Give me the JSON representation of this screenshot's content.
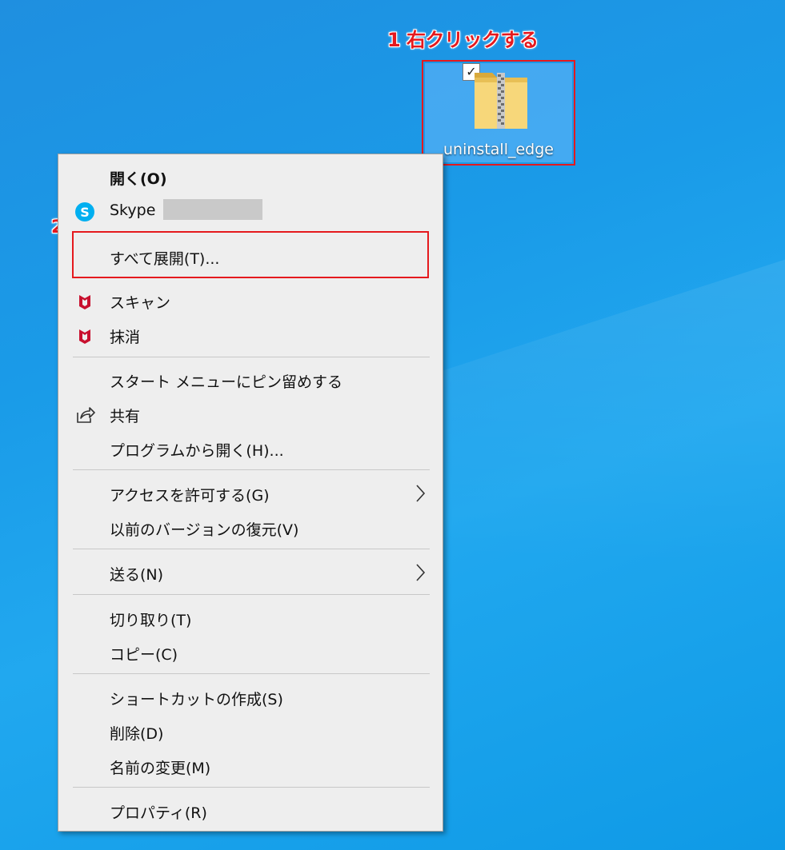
{
  "annotations": {
    "step1": "1 右クリックする",
    "step2": "2"
  },
  "desktop_icon": {
    "label": "uninstall_edge",
    "checkbox_mark": "✓",
    "icon_name": "zip-folder-icon"
  },
  "context_menu": {
    "items": [
      {
        "label": "開く(O)",
        "bold": true
      },
      {
        "label": "Skype",
        "icon": "skype-icon"
      },
      {
        "label": "すべて展開(T)..."
      },
      {
        "label": "スキャン",
        "icon": "mcafee-icon"
      },
      {
        "label": "抹消",
        "icon": "mcafee-icon"
      },
      {
        "label": "スタート メニューにピン留めする"
      },
      {
        "label": "共有",
        "icon": "share-icon"
      },
      {
        "label": "プログラムから開く(H)..."
      },
      {
        "label": "アクセスを許可する(G)",
        "submenu": true
      },
      {
        "label": "以前のバージョンの復元(V)"
      },
      {
        "label": "送る(N)",
        "submenu": true
      },
      {
        "label": "切り取り(T)"
      },
      {
        "label": "コピー(C)"
      },
      {
        "label": "ショートカットの作成(S)"
      },
      {
        "label": "削除(D)"
      },
      {
        "label": "名前の変更(M)"
      },
      {
        "label": "プロパティ(R)"
      }
    ]
  },
  "colors": {
    "annotation": "#e5191e",
    "menu_bg": "#eeeeee",
    "desktop": "#1a9be8",
    "mcafee": "#c8102e",
    "skype": "#00aff0"
  }
}
